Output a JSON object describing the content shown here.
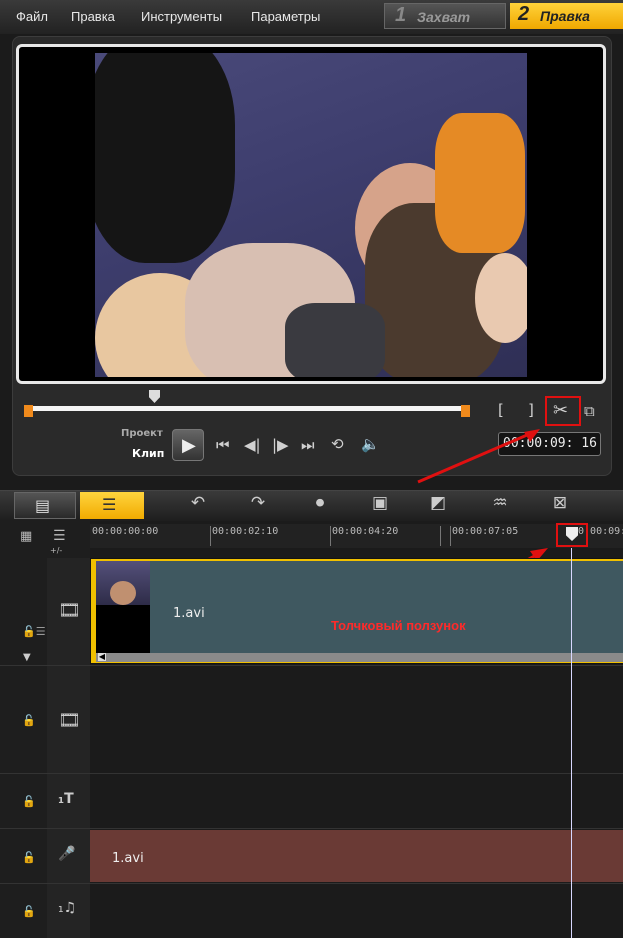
{
  "menu": {
    "items": [
      "Файл",
      "Правка",
      "Инструменты",
      "Параметры"
    ]
  },
  "mode_tabs": {
    "capture": {
      "number": "1",
      "label": "Захват"
    },
    "edit": {
      "number": "2",
      "label": "Правка"
    }
  },
  "player": {
    "label_project": "Проект",
    "label_clip": "Клип",
    "timecode": "00:00:09: 16",
    "mark_in": "[",
    "mark_out": "]",
    "scrub_position": 0.29
  },
  "timeline": {
    "ruler": [
      "00:00:00:00",
      "00:00:02:10",
      "00:00:04:20",
      "00:00:07:05",
      "00:00:09:1"
    ],
    "zoom_label": "+/-",
    "video_clip_name": "1.avi",
    "audio_clip_name": "1.avi"
  },
  "annotation": {
    "label": "Толчковый ползунок"
  },
  "colors": {
    "accent": "#f5b800",
    "annotation": "#e01010",
    "video_clip": "#3f5860",
    "audio_clip": "#6a3a35"
  }
}
